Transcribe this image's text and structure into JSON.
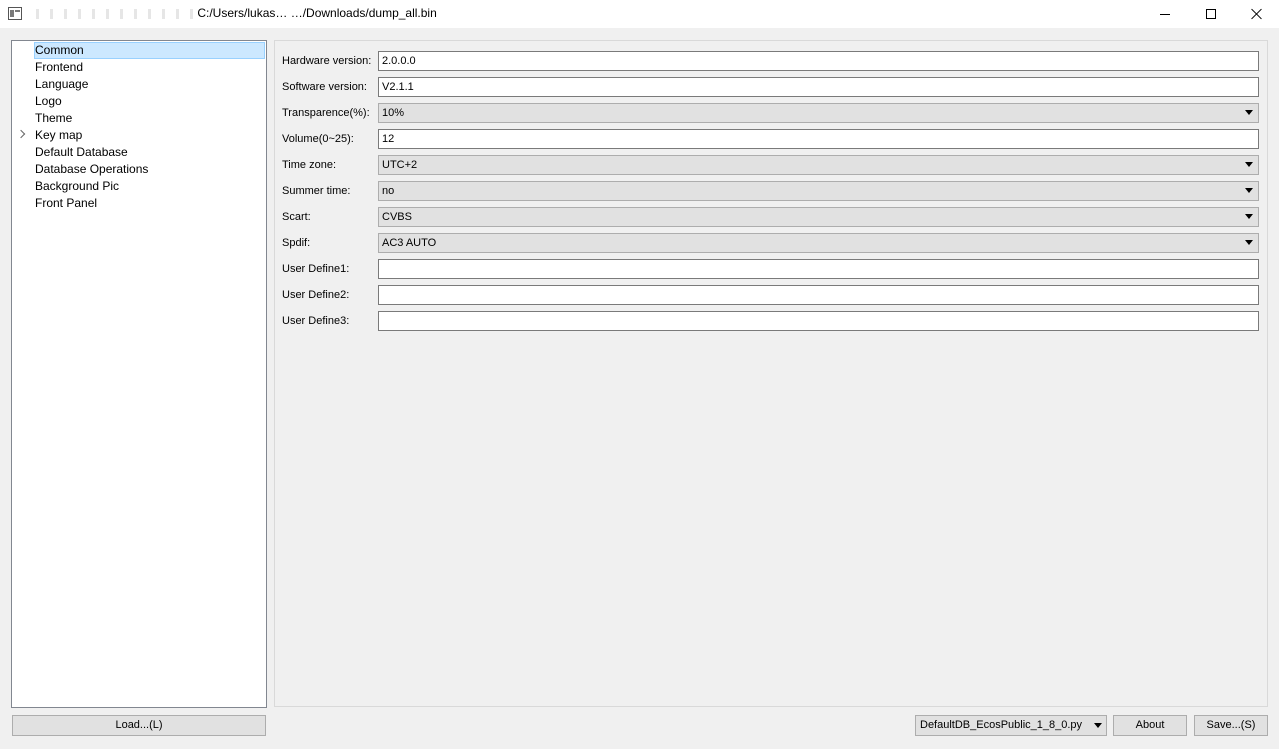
{
  "window": {
    "title_path": "C:/Users/lukas… …/Downloads/dump_all.bin",
    "title_obscured": true,
    "controls": [
      "minimize-icon",
      "maximize-icon",
      "close-icon"
    ]
  },
  "tree": {
    "items": [
      {
        "label": "Common",
        "selected": true,
        "expandable": false
      },
      {
        "label": "Frontend",
        "selected": false,
        "expandable": false
      },
      {
        "label": "Language",
        "selected": false,
        "expandable": false
      },
      {
        "label": "Logo",
        "selected": false,
        "expandable": false
      },
      {
        "label": "Theme",
        "selected": false,
        "expandable": false
      },
      {
        "label": "Key map",
        "selected": false,
        "expandable": true
      },
      {
        "label": "Default Database",
        "selected": false,
        "expandable": false
      },
      {
        "label": "Database Operations",
        "selected": false,
        "expandable": false
      },
      {
        "label": "Background Pic",
        "selected": false,
        "expandable": false
      },
      {
        "label": "Front Panel",
        "selected": false,
        "expandable": false
      }
    ]
  },
  "form": {
    "hardware_version": {
      "label": "Hardware version:",
      "value": "2.0.0.0"
    },
    "software_version": {
      "label": "Software version:",
      "value": "V2.1.1"
    },
    "transparence": {
      "label": "Transparence(%):",
      "value": "10%"
    },
    "volume": {
      "label": "Volume(0~25):",
      "value": "12"
    },
    "time_zone": {
      "label": "Time zone:",
      "value": "UTC+2"
    },
    "summer_time": {
      "label": "Summer time:",
      "value": "no"
    },
    "scart": {
      "label": "Scart:",
      "value": "CVBS"
    },
    "spdif": {
      "label": "Spdif:",
      "value": "AC3 AUTO"
    },
    "user_define1": {
      "label": "User Define1:",
      "value": ""
    },
    "user_define2": {
      "label": "User Define2:",
      "value": ""
    },
    "user_define3": {
      "label": "User Define3:",
      "value": ""
    }
  },
  "footer": {
    "load_label": "Load...(L)",
    "db_selected": "DefaultDB_EcosPublic_1_8_0.py",
    "about_label": "About",
    "save_label": "Save...(S)"
  },
  "colors": {
    "selection_bg": "#cce8ff",
    "selection_border": "#99d1ff",
    "window_bg": "#f0f0f0",
    "button_bg": "#e1e1e1"
  }
}
